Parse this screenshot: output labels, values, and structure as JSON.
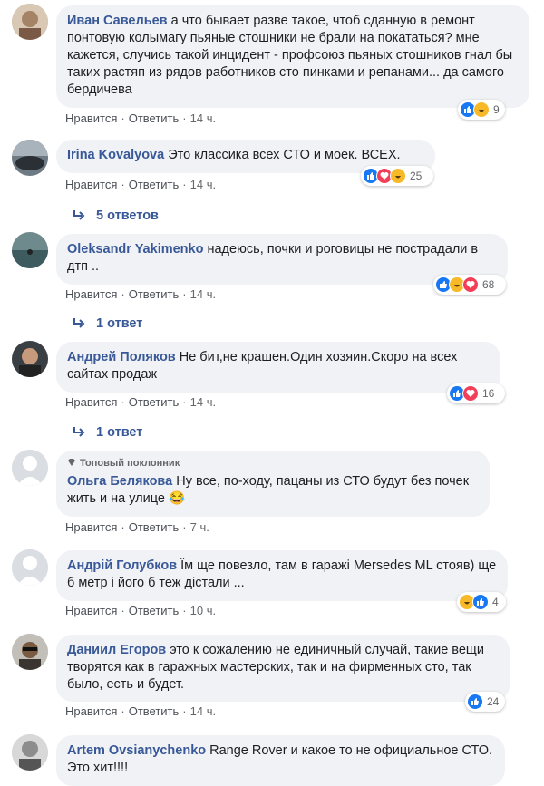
{
  "colors": {
    "link": "#385898",
    "bubble": "#f0f2f5",
    "meta": "#65676b",
    "like": "#1877f2",
    "love": "#f33e58",
    "haha": "#f7b928"
  },
  "comments": [
    {
      "author": "Иван Савельев",
      "text": "а что бывает разве такое, чтоб сданную в ремонт понтовую колымагу пьяные стошники не брали на покататься? мне кажется, случись такой инцидент - профсоюз пьяных стошников гнал бы таких растяп из рядов работников сто пинками и репанами... да самого бердичева",
      "like": "Нравится",
      "reply": "Ответить",
      "time": "14 ч.",
      "reactions": [
        "like",
        "haha"
      ],
      "reaction_count": "9"
    },
    {
      "author": "Irina Kovalyova",
      "text": "Это классика всех СТО и моек. ВСЕХ.",
      "like": "Нравится",
      "reply": "Ответить",
      "time": "14 ч.",
      "reactions": [
        "like",
        "love",
        "haha"
      ],
      "reaction_count": "25",
      "replies": "5 ответов"
    },
    {
      "author": "Oleksandr Yakimenko",
      "text": "надеюсь, почки и роговицы не пострадали в дтп ..",
      "like": "Нравится",
      "reply": "Ответить",
      "time": "14 ч.",
      "reactions": [
        "like",
        "haha",
        "love"
      ],
      "reaction_count": "68",
      "replies": "1 ответ"
    },
    {
      "author": "Андрей Поляков",
      "text": "Не бит,не крашен.Один хозяин.Скоро на всех сайтах продаж",
      "like": "Нравится",
      "reply": "Ответить",
      "time": "14 ч.",
      "reactions": [
        "like",
        "love"
      ],
      "reaction_count": "16",
      "replies": "1 ответ"
    },
    {
      "badge": "Топовый поклонник",
      "author": "Ольга Белякова",
      "text": "Ну все, по-ходу, пацаны из СТО будут без почек жить и на улице",
      "emoji": "😂",
      "like": "Нравится",
      "reply": "Ответить",
      "time": "7 ч."
    },
    {
      "author": "Андрій Голубков",
      "text": "Їм ще повезло, там в гаражі Mersedes ML стояв) ще б метр і його б теж дістали ...",
      "like": "Нравится",
      "reply": "Ответить",
      "time": "10 ч.",
      "reactions": [
        "haha",
        "like"
      ],
      "reaction_count": "4"
    },
    {
      "author": "Даниил Егоров",
      "text": "это к сожалению не единичный случай, такие вещи творятся как в гаражных мастерских, так и на фирменных сто, так было, есть и будет.",
      "like": "Нравится",
      "reply": "Ответить",
      "time": "14 ч.",
      "reactions": [
        "like"
      ],
      "reaction_count": "24"
    },
    {
      "author": "Artem Ovsianychenko",
      "text": "Range Rover и какое то не официальное СТО. Это хит!!!!"
    }
  ]
}
